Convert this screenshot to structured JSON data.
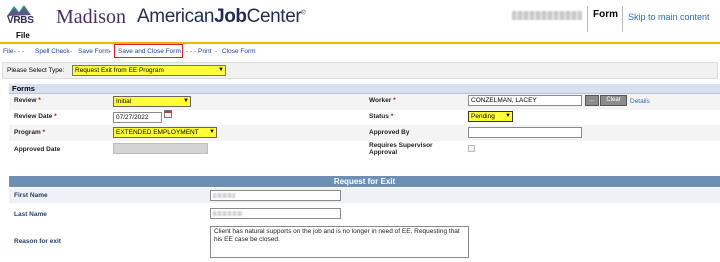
{
  "header": {
    "logo_text": "VRBS",
    "madison": "Madison",
    "ajc_prefix": "American",
    "ajc_bold": "Job",
    "ajc_suffix": "Center",
    "ajc_tm": "®",
    "file_label": "File",
    "form_label": "Form",
    "skip_link": "Skip to main content"
  },
  "menubar": {
    "file": "File",
    "dashes1": "- - -",
    "spell_check": "Spell Check",
    "save_form": "Save Form",
    "save_close": "Save and Close Form",
    "dashes2": "- - -",
    "print": "Print",
    "close_form": "Close Form",
    "sep": "-"
  },
  "type_row": {
    "label": "Please Select Type:",
    "selected": "Request Exit from EE Program"
  },
  "forms": {
    "title": "Forms",
    "review_label": "Review",
    "review_value": "Initial",
    "review_date_label": "Review Date",
    "review_date_value": "07/27/2022",
    "program_label": "Program",
    "program_value": "EXTENDED EMPLOYMENT",
    "approved_date_label": "Approved Date",
    "worker_label": "Worker",
    "worker_value": "CONZELMAN, LACEY",
    "clear_button": "Clear",
    "details_link": "Details",
    "status_label": "Status",
    "status_value": "Pending",
    "approved_by_label": "Approved By",
    "requires_supervisor_label": "Requires Supervisor Approval",
    "required_mark": "*",
    "browse_button": "..."
  },
  "request_for_exit": {
    "title": "Request for Exit",
    "first_name_label": "First Name",
    "last_name_label": "Last Name",
    "reason_label": "Reason for exit",
    "reason_text": "Client has natural supports on the job and is no longer in need of EE. Requesting that his EE case be closed."
  },
  "colors": {
    "highlight": "#ffff33",
    "accent_bar": "#e6b800",
    "link": "#2b6dbd",
    "menu_link": "#1a3fa6",
    "section_header": "#6d8fb3",
    "required": "#d00000"
  },
  "icons": {
    "calendar": "calendar-icon",
    "dropdown": "chevron-down-icon",
    "checkbox": "checkbox"
  }
}
